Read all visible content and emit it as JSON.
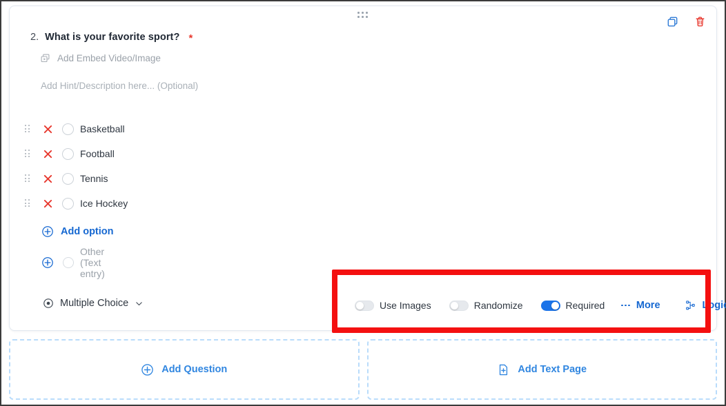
{
  "card": {
    "drag_handle": "drag-handle",
    "duplicate_label": "Duplicate",
    "delete_label": "Delete"
  },
  "question": {
    "number": "2.",
    "title": "What is your favorite sport?",
    "required_marker": "*",
    "embed_label": "Add Embed Video/Image",
    "hint_placeholder": "Add Hint/Description here... (Optional)",
    "options": [
      {
        "label": "Basketball"
      },
      {
        "label": "Football"
      },
      {
        "label": "Tennis"
      },
      {
        "label": "Ice Hockey"
      }
    ],
    "add_option_label": "Add option",
    "other_option_label": "Other (Text entry)",
    "type_label": "Multiple Choice"
  },
  "settings": {
    "use_images": {
      "label": "Use Images",
      "on": false
    },
    "randomize": {
      "label": "Randomize",
      "on": false
    },
    "required": {
      "label": "Required",
      "on": true
    },
    "more_label": "More",
    "logic_label": "Logic"
  },
  "footer": {
    "add_question_label": "Add Question",
    "add_text_page_label": "Add Text Page"
  },
  "colors": {
    "accent_blue": "#1668d1",
    "toggle_on": "#1a73e8",
    "delete_red": "#e8392f",
    "highlight_red": "#f41010",
    "dashed_border": "#b9dcfb"
  }
}
